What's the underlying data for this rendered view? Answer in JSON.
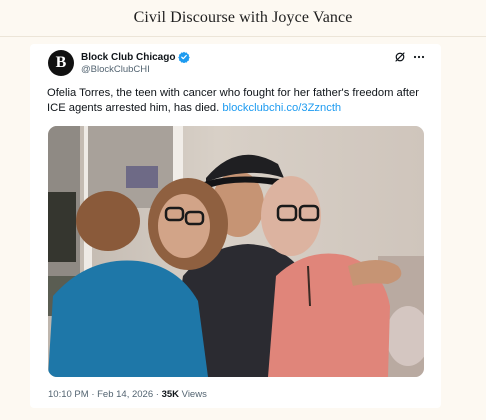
{
  "header": {
    "title": "Civil Discourse with Joyce Vance"
  },
  "tweet": {
    "avatar_letter": "B",
    "display_name": "Block Club Chicago",
    "handle": "@BlockClubCHI",
    "text": "Ofelia Torres, the teen with cancer who fought for her father's freedom after ICE agents arrested him, has died.",
    "link": "blockclubchi.co/3Zzncth",
    "time": "10:10 PM",
    "separator": "·",
    "date": "Feb 14, 2026",
    "views_count": "35K",
    "views_label": "Views",
    "icons": [
      "verified-badge-icon",
      "grok-icon",
      "more-options-icon"
    ],
    "accent_color": "#1d9bf0"
  }
}
